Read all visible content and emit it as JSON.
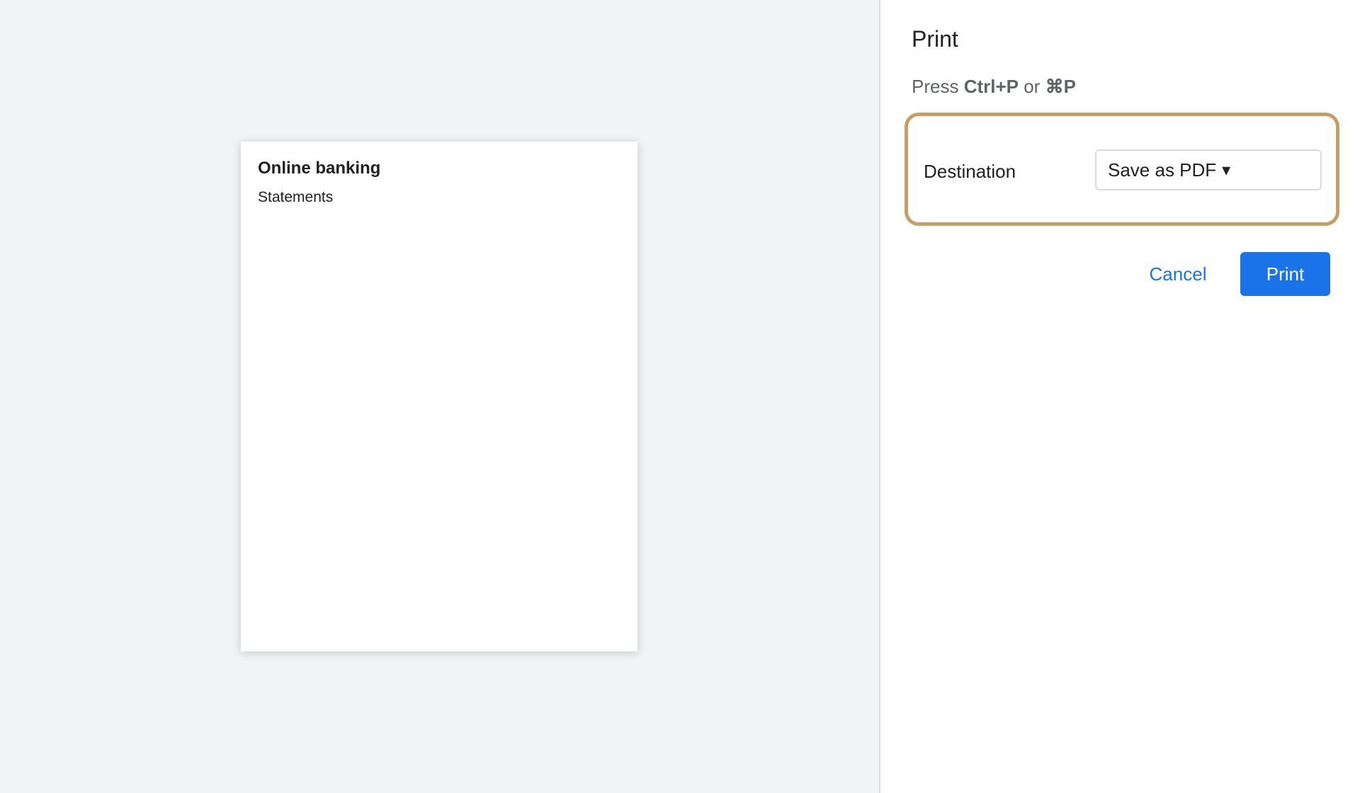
{
  "preview": {
    "title": "Online banking",
    "subtitle": "Statements"
  },
  "panel": {
    "title": "Print",
    "hint_prefix": "Press ",
    "hint_key_1": "Ctrl+P",
    "hint_middle": " or ",
    "hint_key_2": "⌘P",
    "destination_label": "Destination",
    "destination_value": "Save as PDF",
    "caret_glyph": "▾",
    "cancel_label": "Cancel",
    "print_label": "Print"
  },
  "colors": {
    "accent": "#1a73e8",
    "highlight_border": "#c5a062",
    "preview_background": "#f1f3f4"
  }
}
